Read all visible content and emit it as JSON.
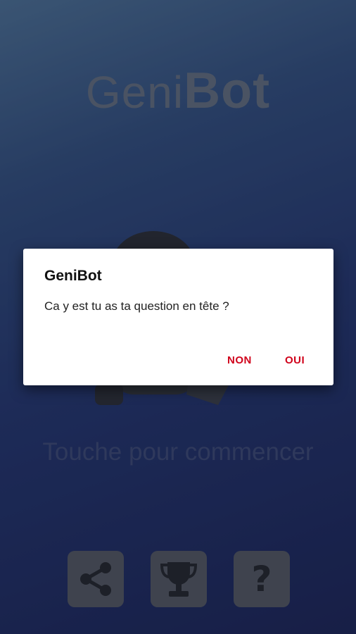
{
  "app": {
    "title_light": "Geni",
    "title_bold": "Bot",
    "start_hint": "Touche pour commencer"
  },
  "toolbar": {
    "share_icon": "share-icon",
    "trophy_icon": "trophy-icon",
    "help_label": "?"
  },
  "dialog": {
    "title": "GeniBot",
    "message": "Ca y est tu as ta question en tête ?",
    "negative_label": "NON",
    "positive_label": "OUI"
  },
  "colors": {
    "accent": "#d0021b",
    "button_bg": "#50555e",
    "title_color": "#5f6a7a"
  }
}
